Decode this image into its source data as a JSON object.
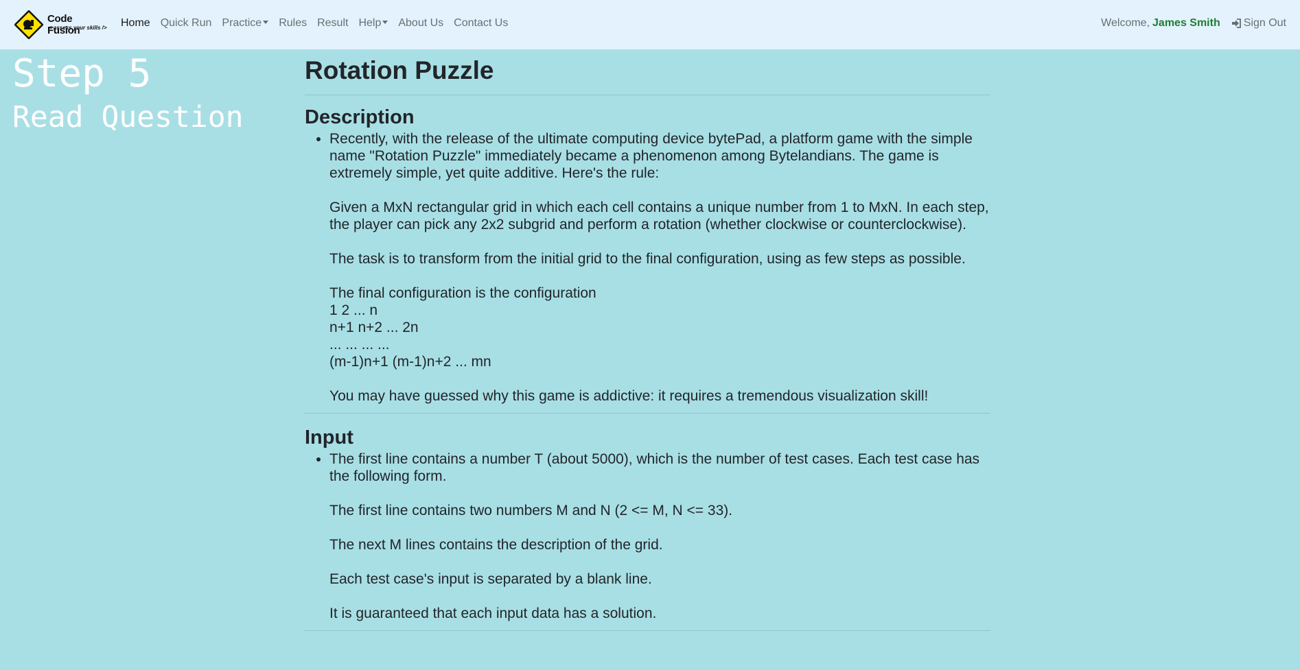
{
  "brand": {
    "name": "Code Fusion",
    "tagline": "< assess your skills />"
  },
  "nav": {
    "items": [
      {
        "label": "Home",
        "active": true
      },
      {
        "label": "Quick Run"
      },
      {
        "label": "Practice",
        "dropdown": true
      },
      {
        "label": "Rules"
      },
      {
        "label": "Result"
      },
      {
        "label": "Help",
        "dropdown": true
      },
      {
        "label": "About Us"
      },
      {
        "label": "Contact Us"
      }
    ],
    "welcome": "Welcome,",
    "user": "James Smith",
    "signout": "Sign Out",
    "signout_icon": "sign-in-icon"
  },
  "sidebar": {
    "step": "Step 5",
    "subtitle": "Read Question"
  },
  "problem": {
    "title": "Rotation Puzzle",
    "description": {
      "heading": "Description",
      "paragraphs": [
        "Recently, with the release of the ultimate computing device bytePad, a platform game with the simple name \"Rotation Puzzle\" immediately became a phenomenon among Bytelandians. The game is extremely simple, yet quite additive. Here's the rule:",
        "Given a MxN rectangular grid in which each cell contains a unique number from 1 to MxN. In each step, the player can pick any 2x2 subgrid and perform a rotation (whether clockwise or counterclockwise).",
        "The task is to transform from the initial grid to the final configuration, using as few steps as possible."
      ],
      "final_config_label": "The final configuration is the configuration",
      "config_lines": [
        "1 2 ... n",
        "n+1 n+2 ... 2n",
        "... ... ... ...",
        "(m-1)n+1 (m-1)n+2 ... mn"
      ],
      "closing": "You may have guessed why this game is addictive: it requires a tremendous visualization skill!"
    },
    "input": {
      "heading": "Input",
      "paragraphs": [
        "The first line contains a number T (about 5000), which is the number of test cases. Each test case has the following form.",
        "The first line contains two numbers M and N (2 <= M, N <= 33).",
        "The next M lines contains the description of the grid.",
        "Each test case's input is separated by a blank line.",
        "It is guaranteed that each input data has a solution."
      ]
    }
  },
  "colors": {
    "page_background": "#a8dfe5",
    "navbar_background": "#e3f2fd",
    "username": "#1e7e34",
    "logo_yellow": "#ffe100"
  }
}
